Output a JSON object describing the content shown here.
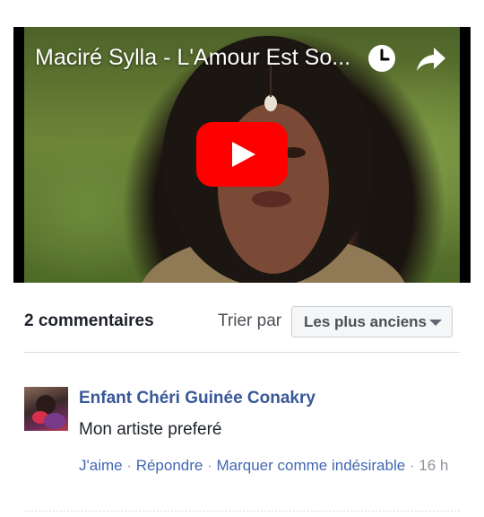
{
  "video": {
    "title": "Maciré Sylla - L'Amour Est So...",
    "icons": {
      "watch_later": "clock-icon",
      "share": "share-arrow-icon",
      "play": "youtube-play-icon"
    },
    "play_color": "#ff0000"
  },
  "comments": {
    "count_label": "2 commentaires",
    "sort_label": "Trier par",
    "sort_value": "Les plus anciens"
  },
  "comment": {
    "author": "Enfant Chéri Guinée Conakry",
    "text": "Mon artiste preferé",
    "like": "J'aime",
    "reply": "Répondre",
    "mark_spam": "Marquer comme indésirable",
    "separator": " · ",
    "time": "16 h"
  },
  "colors": {
    "link": "#4267b2",
    "author": "#385898",
    "muted": "#90949c",
    "divider": "#dadde1"
  }
}
